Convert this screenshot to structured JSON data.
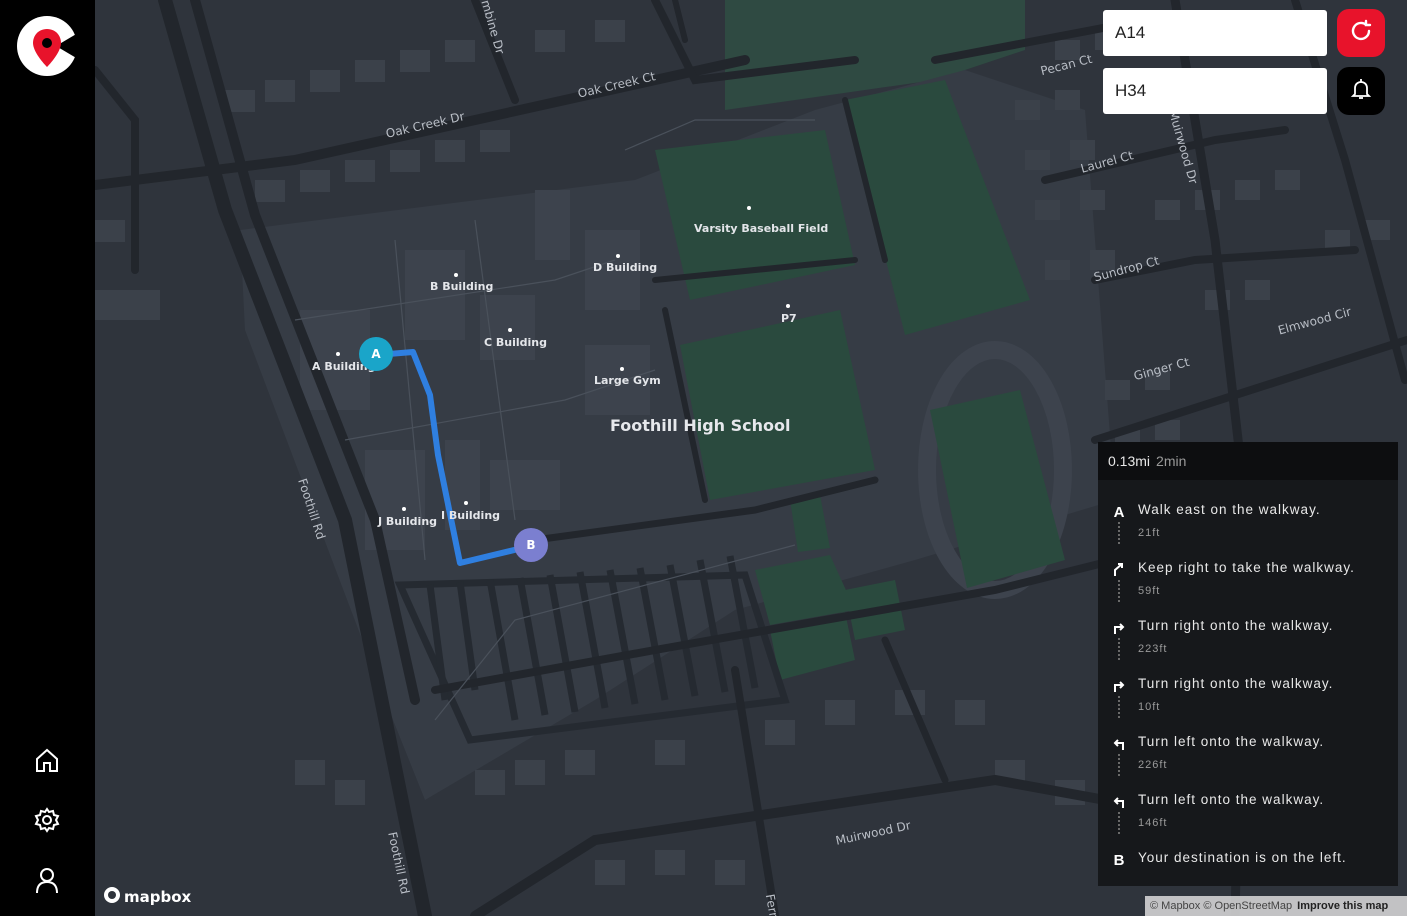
{
  "inputs": {
    "origin_value": "A14",
    "destination_value": "H34"
  },
  "icons": {
    "logo": "map-pin-logo-icon",
    "refresh": "refresh-icon",
    "bell": "bell-icon",
    "home": "home-icon",
    "settings": "gear-icon",
    "profile": "user-icon"
  },
  "colors": {
    "accent_red": "#e8132b",
    "route_blue": "#2f7fe0",
    "marker_a": "#1aa5c9",
    "marker_b": "#7b7fd0"
  },
  "map": {
    "streets": [
      "Oak Creek Dr",
      "Oak Creek Ct",
      "Pecan Ct",
      "Laurel Ct",
      "Sundrop Ct",
      "Elmwood Cir",
      "Ginger Ct",
      "Foothill Rd",
      "Foothill Rd",
      "Muirwood Dr",
      "Muirwood Dr",
      "mbine Dr",
      "Fern"
    ],
    "places": [
      "Varsity Baseball Field",
      "D Building",
      "B Building",
      "C Building",
      "A Building",
      "Large Gym",
      "P7",
      "J Building",
      "I Building"
    ],
    "school_name": "Foothill High School",
    "marker_a": "A",
    "marker_b": "B"
  },
  "directions": {
    "distance": "0.13mi",
    "duration": "2min",
    "steps": [
      {
        "icon": "A",
        "text": "Walk east on the walkway.",
        "dist": "21ft"
      },
      {
        "icon": "slight-right-arrow-icon",
        "text": "Keep right to take the walkway.",
        "dist": "59ft"
      },
      {
        "icon": "turn-right-arrow-icon",
        "text": "Turn right onto the walkway.",
        "dist": "223ft"
      },
      {
        "icon": "turn-right-arrow-icon",
        "text": "Turn right onto the walkway.",
        "dist": "10ft"
      },
      {
        "icon": "turn-left-arrow-icon",
        "text": "Turn left onto the walkway.",
        "dist": "226ft"
      },
      {
        "icon": "turn-left-arrow-icon",
        "text": "Turn left onto the walkway.",
        "dist": "146ft"
      },
      {
        "icon": "B",
        "text": "Your destination is on the left.",
        "dist": ""
      }
    ]
  },
  "attribution": {
    "brand": "mapbox",
    "text": "© Mapbox © OpenStreetMap",
    "improve": "Improve this map"
  }
}
